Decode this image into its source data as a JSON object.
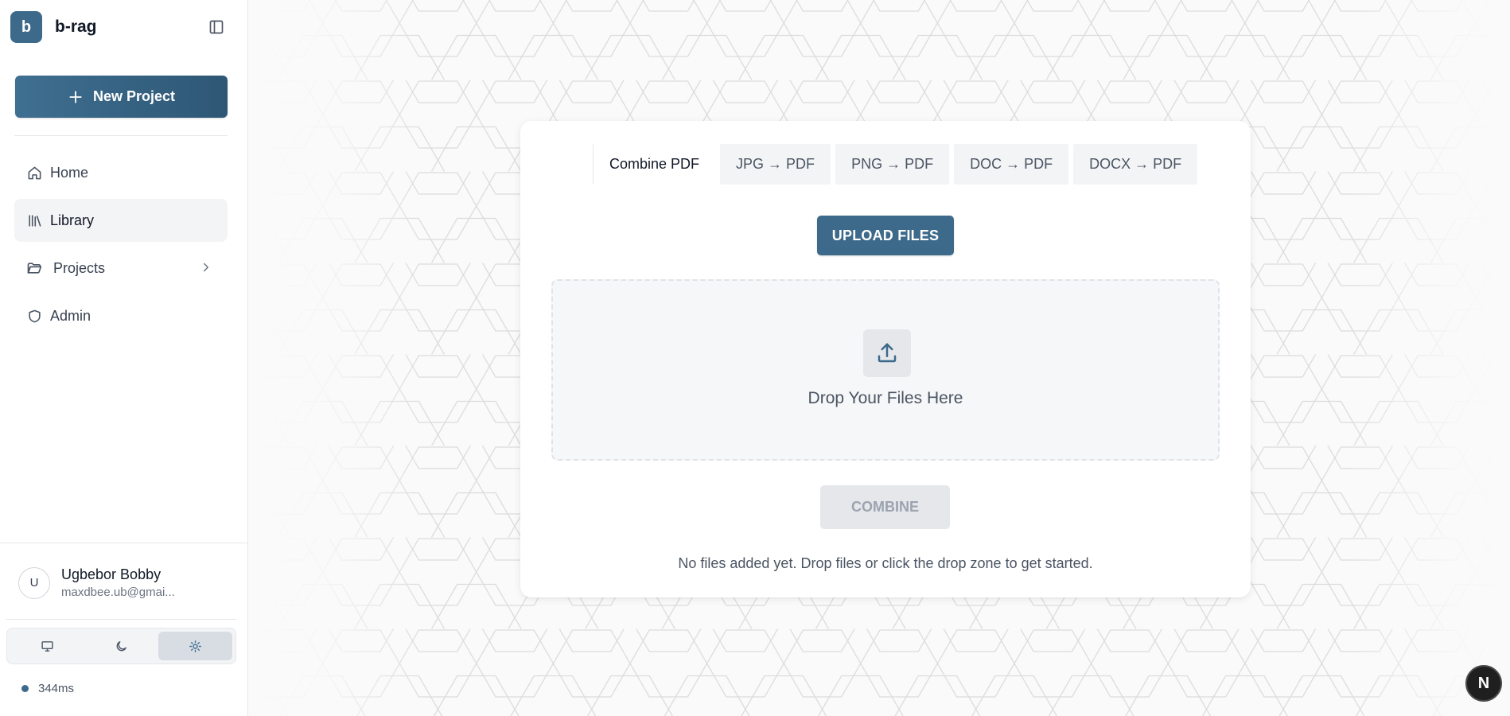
{
  "brand": {
    "logo_letter": "b",
    "name": "b-rag"
  },
  "sidebar": {
    "new_project_label": "New Project",
    "nav": [
      {
        "label": "Home",
        "icon": "home-icon"
      },
      {
        "label": "Library",
        "icon": "library-icon",
        "active": true
      },
      {
        "label": "Projects",
        "icon": "folder-icon",
        "has_submenu": true
      },
      {
        "label": "Admin",
        "icon": "shield-icon"
      }
    ],
    "user": {
      "avatar_letter": "U",
      "name": "Ugbebor Bobby",
      "email": "maxdbee.ub@gmai..."
    },
    "theme_options": [
      {
        "name": "system",
        "icon": "monitor-icon"
      },
      {
        "name": "dark",
        "icon": "moon-icon"
      },
      {
        "name": "light",
        "icon": "sun-icon",
        "active": true
      }
    ],
    "latency": "344ms"
  },
  "main": {
    "tabs": [
      {
        "label": "Combine PDF",
        "active": true
      },
      {
        "label": "JPG → PDF"
      },
      {
        "label": "PNG → PDF"
      },
      {
        "label": "DOC → PDF"
      },
      {
        "label": "DOCX → PDF"
      }
    ],
    "upload_label": "UPLOAD FILES",
    "dropzone_text": "Drop Your Files Here",
    "combine_label": "COMBINE",
    "hint_text": "No files added yet. Drop files or click the drop zone to get started."
  },
  "badge_letter": "N",
  "colors": {
    "accent": "#3d6a8a",
    "sidebar_bg": "#ffffff",
    "page_bg": "#fafafa"
  }
}
